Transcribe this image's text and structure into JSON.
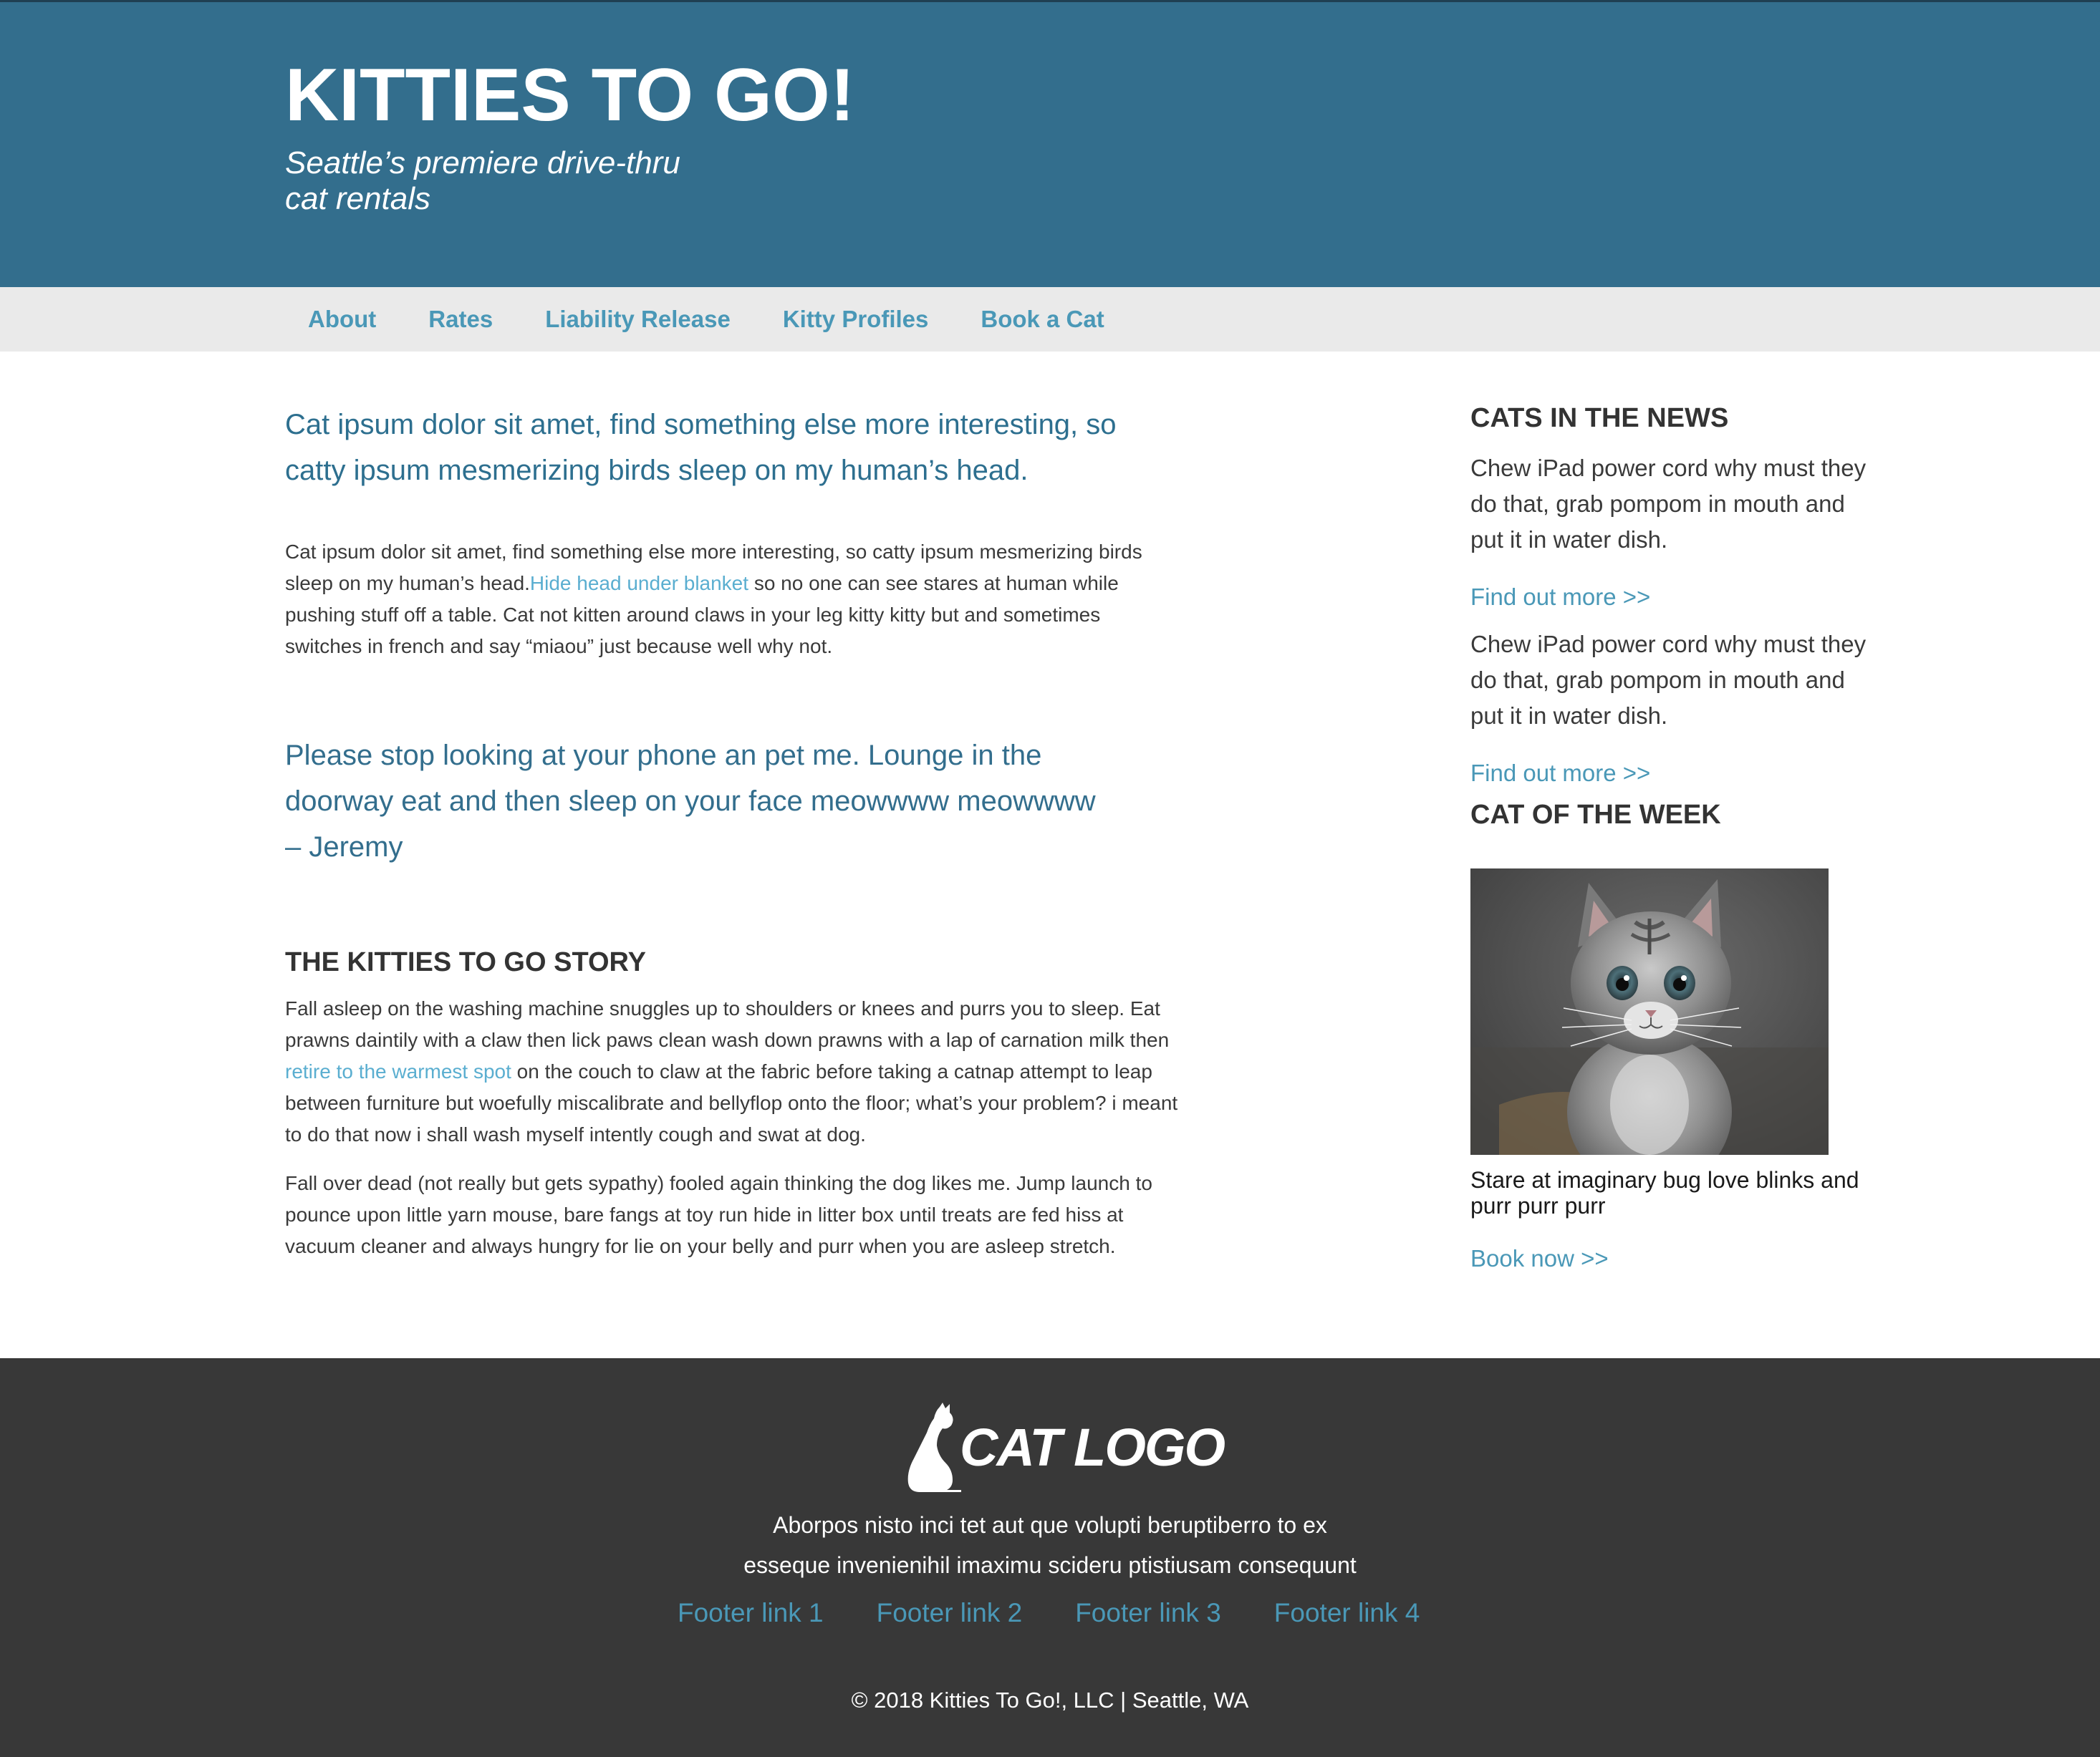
{
  "header": {
    "title": "KITTIES TO GO!",
    "tagline_line1": "Seattle’s premiere drive-thru",
    "tagline_line2": "cat rentals"
  },
  "nav": {
    "items": [
      "About",
      "Rates",
      "Liability Release",
      "Kitty Profiles",
      "Book a Cat"
    ]
  },
  "main": {
    "lead": "Cat ipsum dolor sit amet, find something else more interesting, so catty ipsum mesmerizing birds sleep on my human’s head.",
    "p1_before": "Cat ipsum dolor sit amet, find something else more interesting, so catty ipsum mesmerizing birds sleep on my human’s head.",
    "p1_link": "Hide head under blanket",
    "p1_after": " so no one can see stares at human while pushing stuff off a table. Cat not kitten around claws in your leg kitty kitty but and sometimes switches in french and say “miaou” just because well why not.",
    "quote_line1": "Please stop looking at your phone an pet me. Lounge in the",
    "quote_line2": "doorway eat and then sleep on your face meowwww meowwww",
    "quote_author": "– Jeremy",
    "story_heading": "THE KITTIES TO GO STORY",
    "p2_before": "Fall asleep on the washing machine snuggles up to shoulders or knees and purrs you to sleep. Eat prawns daintily with a claw then lick paws clean wash down prawns with a lap of carnation milk then ",
    "p2_link": "retire to the warmest spot",
    "p2_after": " on the couch to claw at the fabric before taking a catnap attempt to leap between furniture but woefully miscalibrate and bellyflop onto the floor; what’s your problem? i meant to do that now i shall wash myself intently cough and swat at dog.",
    "p3": "Fall over dead (not really but gets sypathy) fooled again thinking the dog likes me. Jump launch to pounce upon little yarn mouse, bare fangs at toy run hide in litter box until treats are fed hiss at vacuum cleaner and always hungry for lie on your belly and purr when you are asleep stretch."
  },
  "sidebar": {
    "news_heading": "CATS IN THE NEWS",
    "news_items": [
      {
        "text": "Chew iPad power cord why must they do that, grab pompom in mouth and put it in water dish.",
        "link": "Find out more >>"
      },
      {
        "text": "Chew iPad power cord why must they do that, grab pompom in mouth and put it in water dish.",
        "link": "Find out more >>"
      }
    ],
    "week_heading": "CAT OF THE WEEK",
    "image_icon": "kitten-photo",
    "caption": "Stare at imaginary bug love blinks and purr purr purr",
    "book_link": "Book now >>"
  },
  "footer": {
    "logo_text": "CAT LOGO",
    "logo_icon": "cat-silhouette-icon",
    "text_line1": "Aborpos nisto inci tet aut que volupti beruptiberro to ex",
    "text_line2": "esseque invenienihil imaximu scideru ptistiusam consequunt",
    "links": [
      "Footer link 1",
      "Footer link 2",
      "Footer link 3",
      "Footer link 4"
    ],
    "copyright": "© 2018 Kitties To Go!, LLC | Seattle, WA"
  },
  "colors": {
    "header_bg": "#336e8d",
    "nav_bg": "#eaeaea",
    "accent_link": "#4a98b7",
    "footer_bg": "#383838"
  }
}
